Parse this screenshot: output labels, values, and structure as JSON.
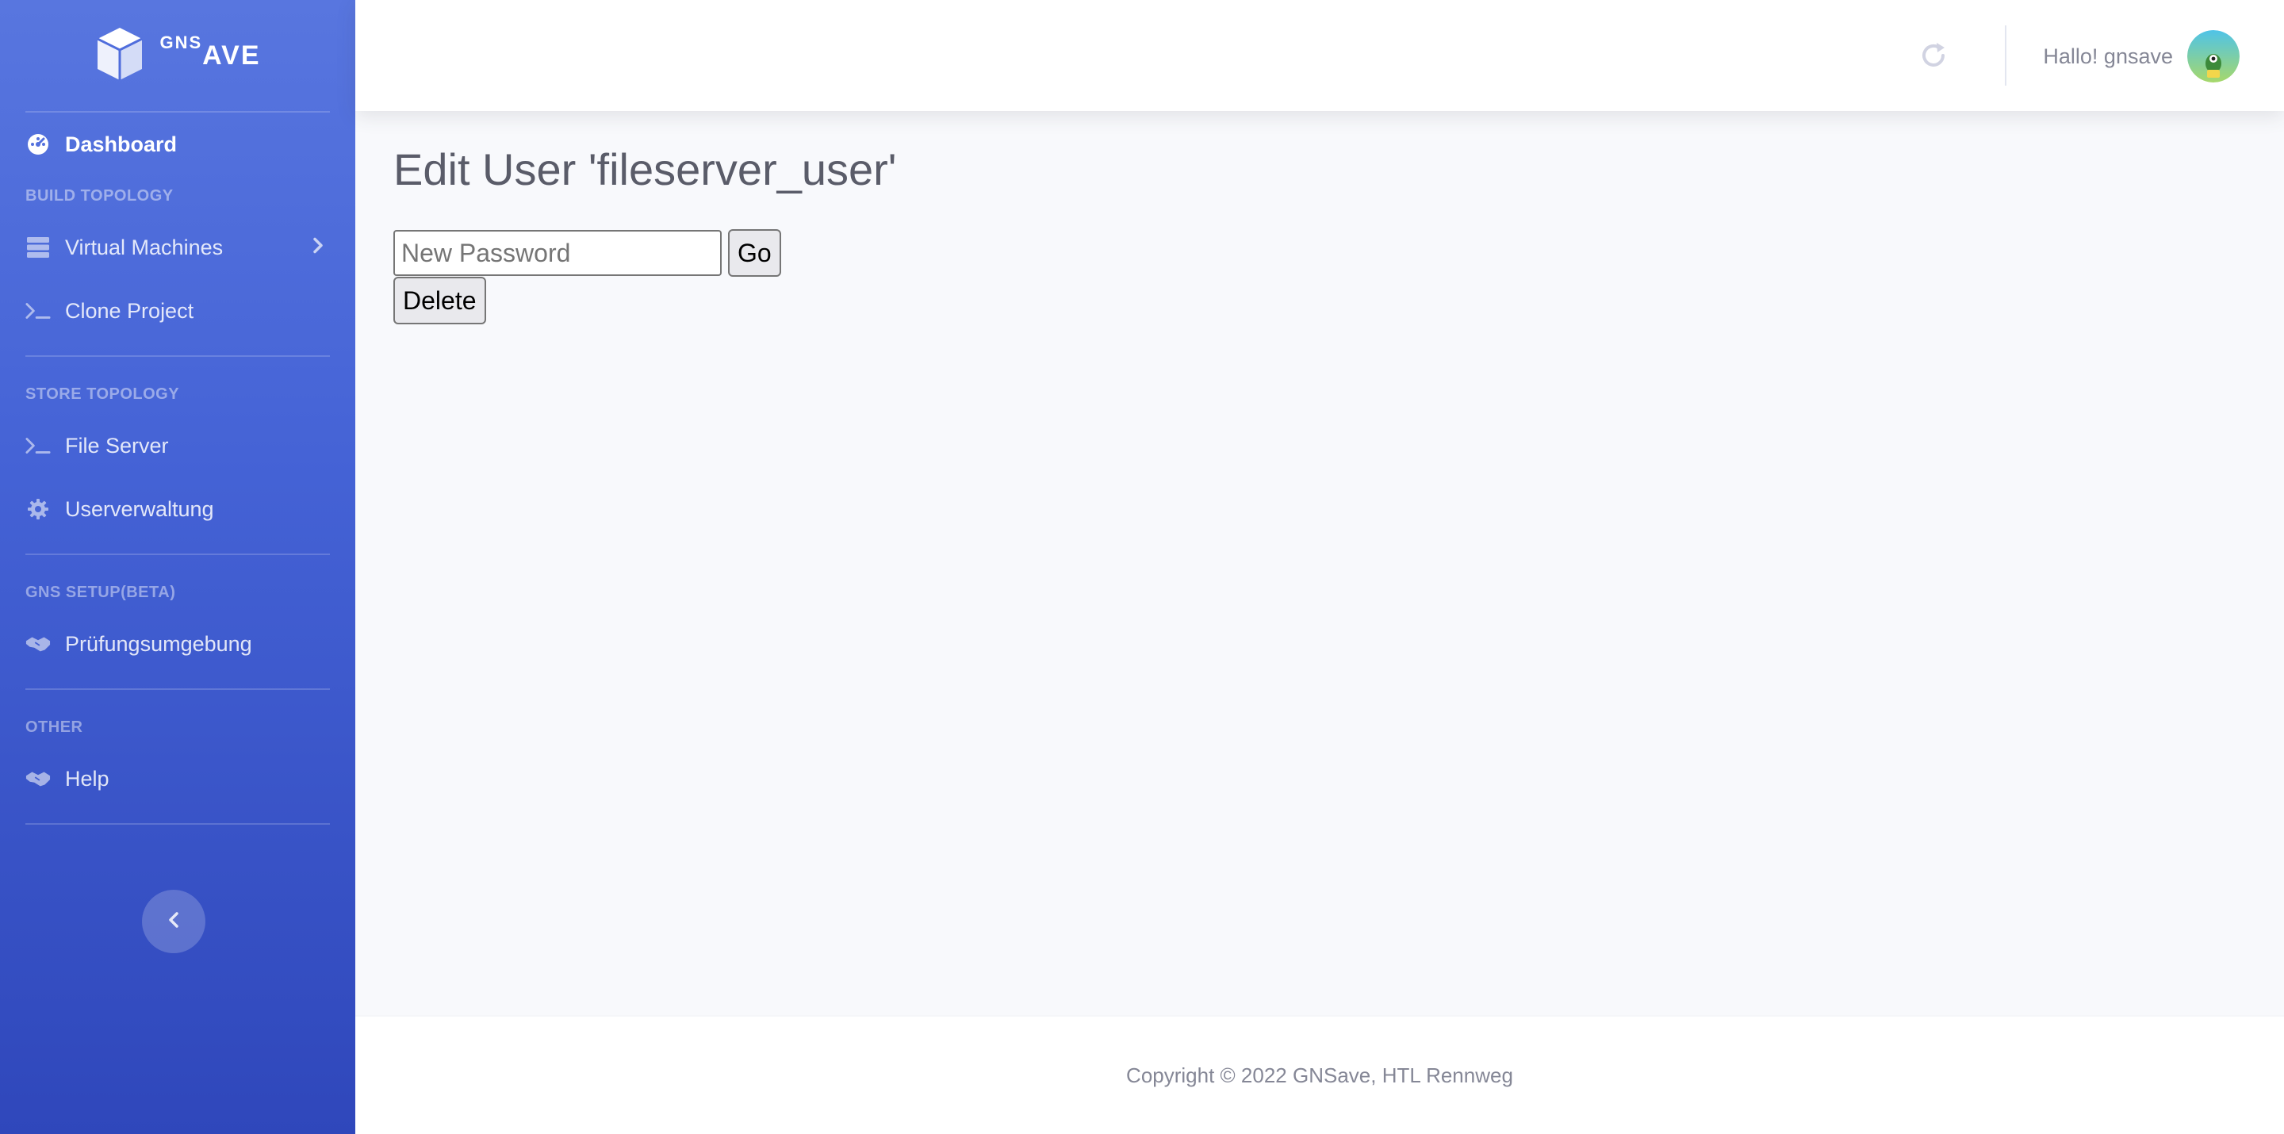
{
  "brand": {
    "sup": "GNS",
    "main": "AVE"
  },
  "sidebar": {
    "dashboard": "Dashboard",
    "sections": [
      {
        "heading": "BUILD TOPOLOGY",
        "items": [
          "Virtual Machines",
          "Clone Project"
        ]
      },
      {
        "heading": "STORE TOPOLOGY",
        "items": [
          "File Server",
          "Userverwaltung"
        ]
      },
      {
        "heading": "GNS SETUP(BETA)",
        "items": [
          "Prüfungsumgebung"
        ]
      },
      {
        "heading": "OTHER",
        "items": [
          "Help"
        ]
      }
    ]
  },
  "topbar": {
    "greeting": "Hallo! gnsave"
  },
  "main": {
    "title": "Edit User 'fileserver_user'",
    "password_placeholder": "New Password",
    "go_label": "Go",
    "delete_label": "Delete"
  },
  "footer": {
    "copyright": "Copyright © 2022 GNSave, HTL Rennweg"
  },
  "colors": {
    "sidebar_top": "#5876df",
    "sidebar_bottom": "#2f47bb",
    "page_bg": "#f8f9fc"
  }
}
